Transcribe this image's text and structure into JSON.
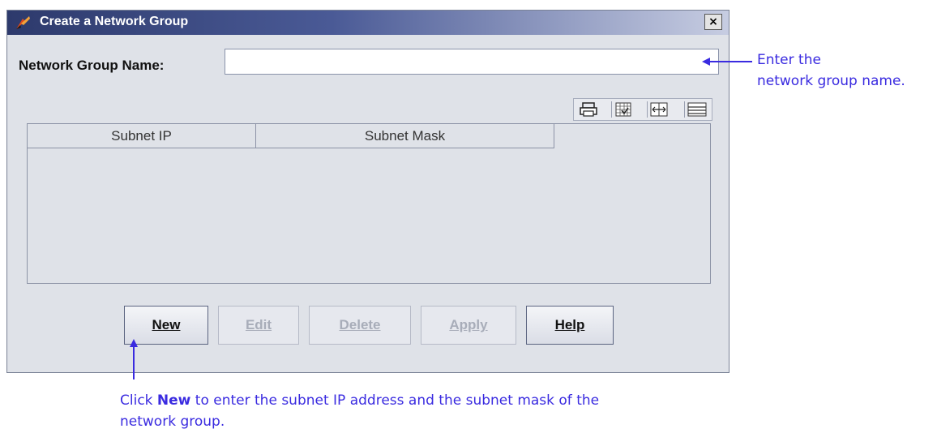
{
  "dialog": {
    "title": "Create a Network Group",
    "close_glyph": "×",
    "name_label": "Network Group Name:",
    "name_value": "",
    "table": {
      "columns": [
        "Subnet IP",
        "Subnet Mask"
      ],
      "rows": []
    },
    "toolbar_icons": [
      "print-icon",
      "table-config-icon",
      "column-width-icon",
      "rows-icon"
    ],
    "buttons": [
      {
        "label": "New",
        "enabled": true
      },
      {
        "label": "Edit",
        "enabled": false
      },
      {
        "label": "Delete",
        "enabled": false
      },
      {
        "label": "Apply",
        "enabled": false
      },
      {
        "label": "Help",
        "enabled": true
      }
    ]
  },
  "annotations": {
    "name_hint_line1": "Enter the",
    "name_hint_line2": "network group name.",
    "new_hint_prefix": "Click ",
    "new_hint_bold": "New",
    "new_hint_suffix": " to enter the subnet IP address and the subnet mask of the",
    "new_hint_line2": "network group."
  },
  "colors": {
    "annotation": "#3a2be0",
    "titlebar": "#2d3a6c"
  }
}
